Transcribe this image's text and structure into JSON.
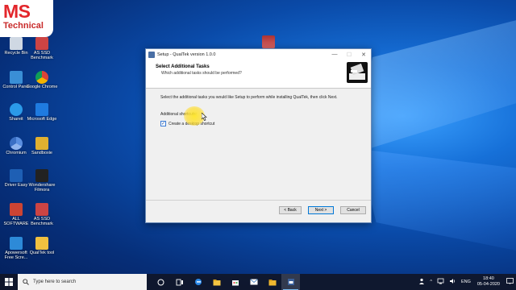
{
  "logo": {
    "line1": "MS",
    "line2": "Technical"
  },
  "desktop_icons": [
    {
      "label": "Recycle Bin"
    },
    {
      "label": "AS SSD Benchmark"
    },
    {
      "label": "Control Panel"
    },
    {
      "label": "Google Chrome"
    },
    {
      "label": "Shareit"
    },
    {
      "label": "Microsoft Edge"
    },
    {
      "label": "Chromium"
    },
    {
      "label": "Sandboxie"
    },
    {
      "label": "Driver Easy"
    },
    {
      "label": "Wondershare Filmora"
    },
    {
      "label": "ALL SOFTWARE"
    },
    {
      "label": "AS SSD Benchmark"
    },
    {
      "label": "Apowersoft Free Scre..."
    },
    {
      "label": "QualTek tool"
    }
  ],
  "window": {
    "title": "Setup - QualTek version 1.0.0",
    "controls": {
      "minimize": "—",
      "maximize": "☐",
      "close": "✕"
    },
    "header_title": "Select Additional Tasks",
    "header_subtitle": "Which additional tasks should be performed?",
    "description": "Select the additional tasks you would like Setup to perform while installing QualTek, then click Next.",
    "shortcuts_label": "Additional shortcuts:",
    "checkbox_label": "Create a desktop shortcut",
    "checkbox_checked": true,
    "buttons": {
      "back": "< Back",
      "next": "Next >",
      "cancel": "Cancel"
    }
  },
  "taskbar": {
    "search_placeholder": "Type here to search",
    "apps": [
      "cortana-icon",
      "task-view-icon",
      "edge-icon",
      "file-explorer-icon",
      "store-icon",
      "mail-icon",
      "folder-icon",
      "setup-app-icon"
    ],
    "tray": {
      "language": "ENG",
      "time": "18:40",
      "date": "05-04-2020"
    }
  },
  "colors": {
    "accent": "#0078d7",
    "logo_red": "#e3262b",
    "taskbar": "#101628"
  }
}
